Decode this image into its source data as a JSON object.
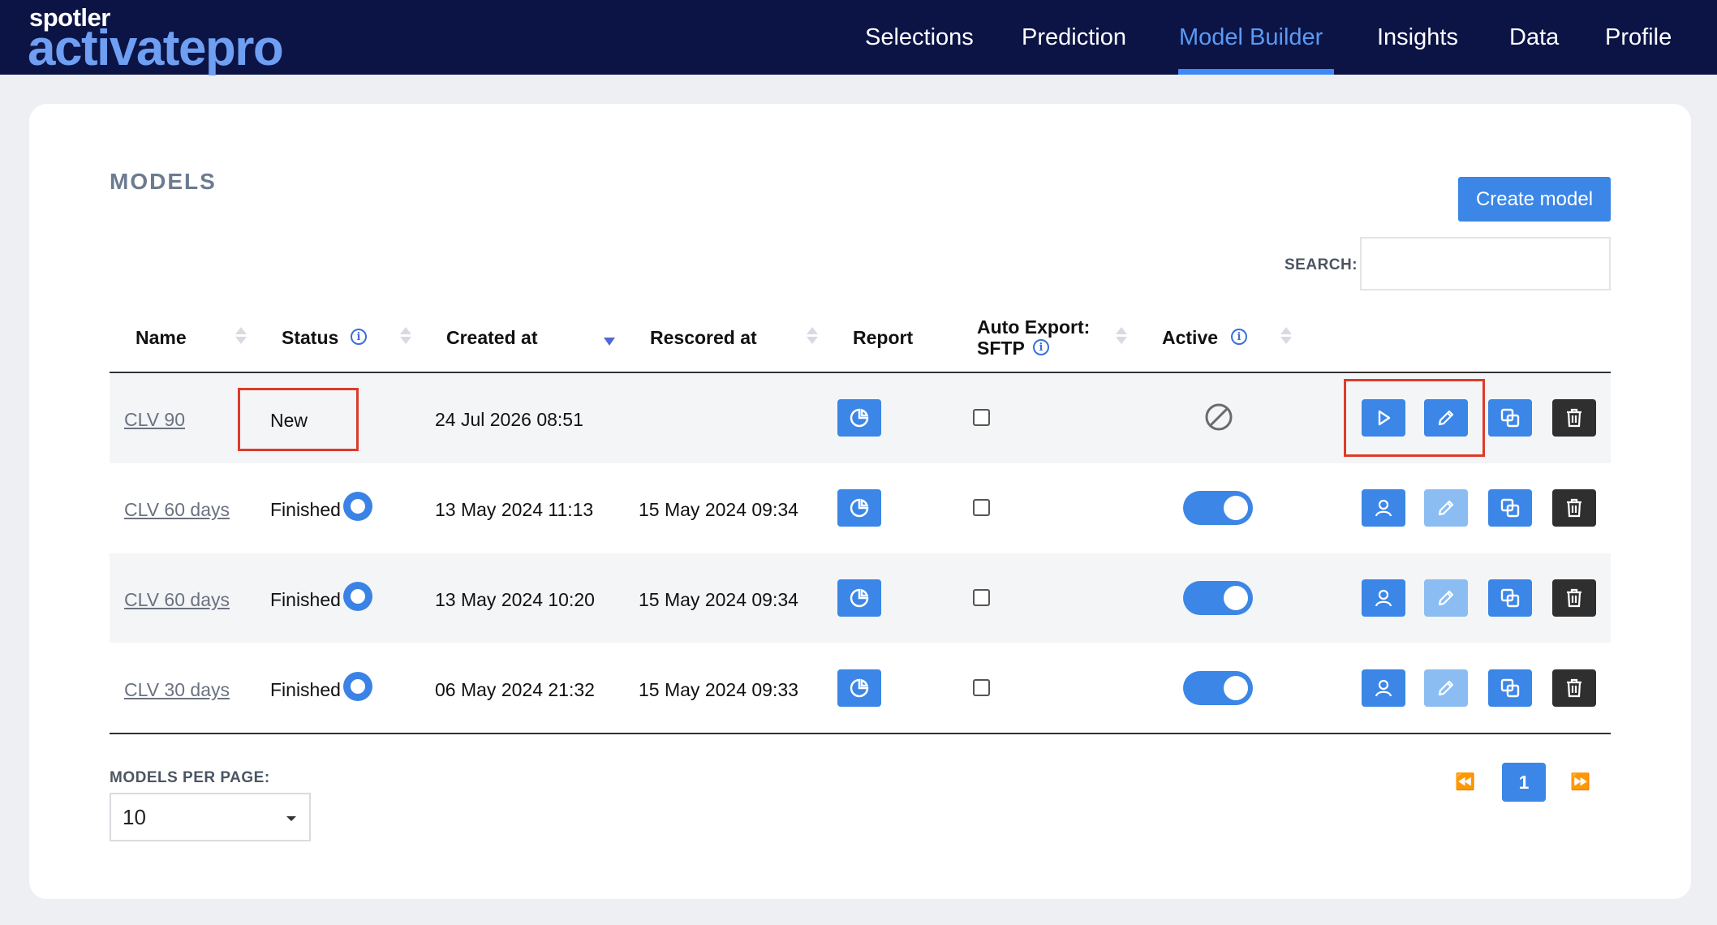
{
  "brand": {
    "small": "spotler",
    "big": "activatepro"
  },
  "nav": {
    "items": [
      {
        "label": "Selections"
      },
      {
        "label": "Prediction"
      },
      {
        "label": "Model Builder",
        "active": true
      },
      {
        "label": "Insights"
      },
      {
        "label": "Data"
      },
      {
        "label": "Profile"
      }
    ]
  },
  "page": {
    "title": "MODELS",
    "create_label": "Create model",
    "search_label": "SEARCH:",
    "search_value": "",
    "search_placeholder": ""
  },
  "table": {
    "headers": {
      "name": "Name",
      "status": "Status",
      "created": "Created at",
      "rescored": "Rescored at",
      "report": "Report",
      "export_line1": "Auto Export:",
      "export_line2": "SFTP",
      "active": "Active"
    },
    "rows": [
      {
        "name": "CLV 90",
        "status": "New",
        "created": "24 Jul 2026 08:51",
        "rescored": "",
        "auto_export": false,
        "active": "disabled",
        "actions": [
          "play",
          "edit",
          "copy",
          "delete"
        ]
      },
      {
        "name": "CLV 60 days",
        "status": "Finished",
        "created": "13 May 2024 11:13",
        "rescored": "15 May 2024 09:34",
        "auto_export": false,
        "active": true,
        "actions": [
          "user",
          "edit-disabled",
          "copy",
          "delete"
        ]
      },
      {
        "name": "CLV 60 days",
        "status": "Finished",
        "created": "13 May 2024 10:20",
        "rescored": "15 May 2024 09:34",
        "auto_export": false,
        "active": true,
        "actions": [
          "user",
          "edit-disabled",
          "copy",
          "delete"
        ]
      },
      {
        "name": "CLV 30 days",
        "status": "Finished",
        "created": "06 May 2024 21:32",
        "rescored": "15 May 2024 09:33",
        "auto_export": false,
        "active": true,
        "actions": [
          "user",
          "edit-disabled",
          "copy",
          "delete"
        ]
      }
    ]
  },
  "pagination": {
    "per_page_label": "MODELS PER PAGE:",
    "per_page_value": "10",
    "current_page": "1",
    "first_symbol": "⏪",
    "last_symbol": "⏩"
  },
  "colors": {
    "header_bg": "#0c1445",
    "accent": "#3b86e6",
    "highlight": "#dd3b2a"
  }
}
